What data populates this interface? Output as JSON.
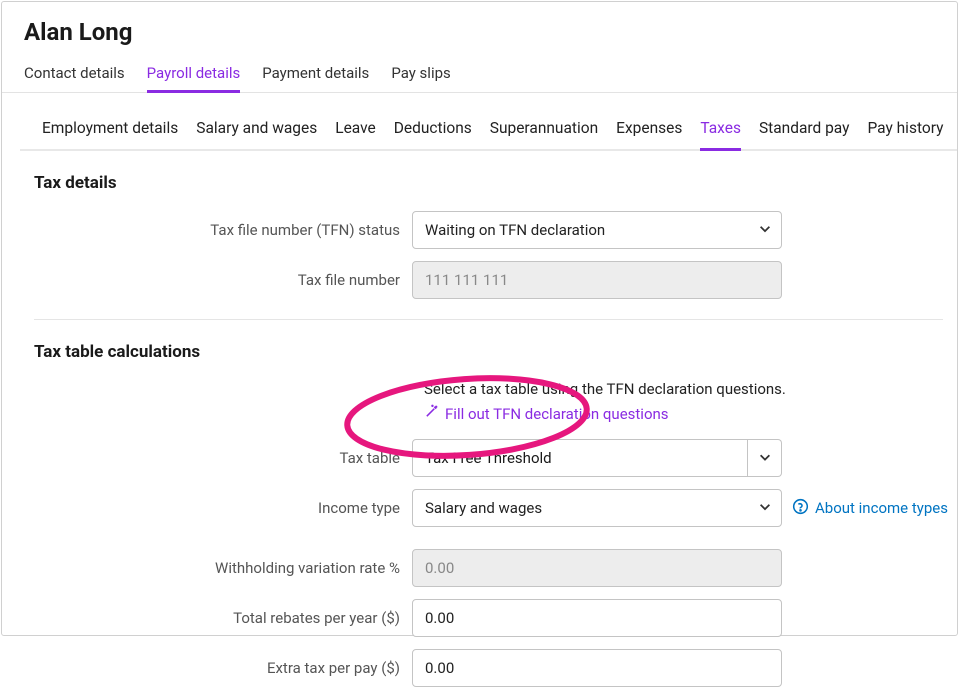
{
  "page": {
    "title": "Alan Long"
  },
  "main_tabs": {
    "contact": "Contact details",
    "payroll": "Payroll details",
    "payment": "Payment details",
    "payslips": "Pay slips"
  },
  "sub_tabs": {
    "employment": "Employment details",
    "salary": "Salary and wages",
    "leave": "Leave",
    "deductions": "Deductions",
    "super": "Superannuation",
    "expenses": "Expenses",
    "taxes": "Taxes",
    "standard": "Standard pay",
    "history": "Pay history"
  },
  "sections": {
    "tax_details": "Tax details",
    "tax_table_calc": "Tax table calculations"
  },
  "fields": {
    "tfn_status": {
      "label": "Tax file number (TFN) status",
      "value": "Waiting on TFN declaration"
    },
    "tfn": {
      "label": "Tax file number",
      "value": "111 111 111"
    },
    "tax_table": {
      "label": "Tax table",
      "value": "Tax Free Threshold"
    },
    "income_type": {
      "label": "Income type",
      "value": "Salary and wages"
    },
    "withholding": {
      "label": "Withholding variation rate %",
      "value": "0.00"
    },
    "rebates": {
      "label": "Total rebates per year ($)",
      "value": "0.00"
    },
    "extra_tax": {
      "label": "Extra tax per pay ($)",
      "value": "0.00"
    }
  },
  "hints": {
    "select_table": "Select a tax table using the TFN declaration questions.",
    "wizard_link": "Fill out TFN declaration questions",
    "about_income": "About income types"
  }
}
